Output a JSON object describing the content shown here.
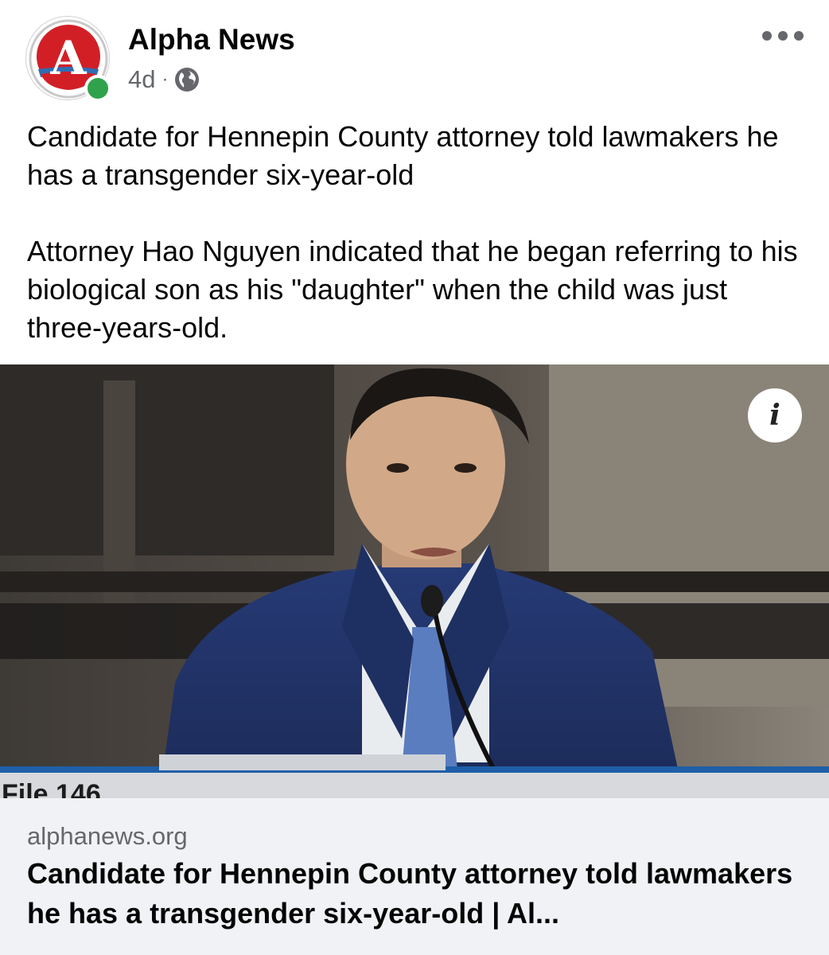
{
  "post": {
    "page_name": "Alpha News",
    "age": "4d",
    "separator": "·",
    "privacy_icon": "globe-icon",
    "avatar_letter": "A",
    "text_paragraph_1": "Candidate for Hennepin County attorney told lawmakers he has a transgender six-year-old",
    "text_paragraph_2": "Attorney Hao Nguyen indicated that he began referring to his biological son as his \"daughter\" when the child was just three-years-old."
  },
  "link": {
    "image_caption": "File 146",
    "info_icon": "i",
    "domain": "alphanews.org",
    "title": "Candidate for Hennepin County attorney told lawmakers he has a transgender six-year-old | Al..."
  },
  "colors": {
    "brand_red": "#d21f26",
    "online_green": "#31a24c",
    "secondary_text": "#65676b",
    "card_background": "#f0f2f5"
  }
}
